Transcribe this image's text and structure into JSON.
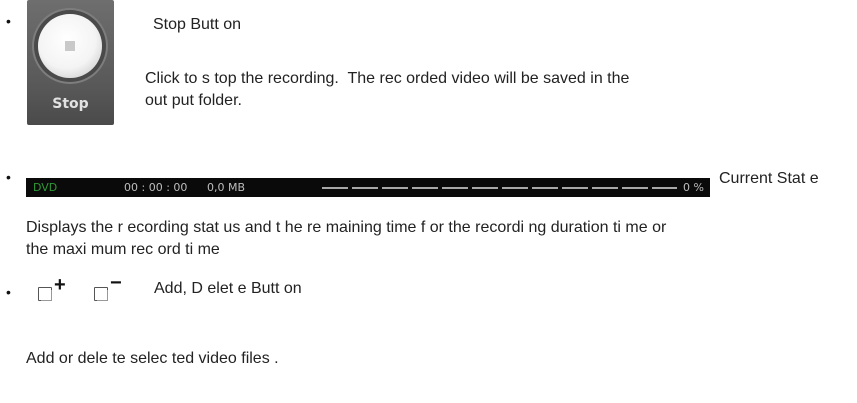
{
  "stop_section": {
    "bullet": "•",
    "button_label": "Stop",
    "title": "Stop Butt on",
    "desc_line1": "Click to s top the recording.  The rec orded video will be saved in the",
    "desc_line2": "out put folder."
  },
  "state_section": {
    "bullet": "•",
    "bar": {
      "mode": "DVD",
      "time": "00 : 00 : 00",
      "size": "0,0 MB",
      "percent_text": "0 %",
      "progress": 0,
      "mode_color": "#2f9a36"
    },
    "title": "Current Stat e",
    "desc_line1": "Displays the r ecording stat us and t he re maining time f or the recordi ng duration ti me or",
    "desc_line2": "the maxi mum rec ord ti me"
  },
  "add_delete_section": {
    "bullet": "•",
    "add_sign": "+",
    "delete_sign": "−",
    "title": "Add, D elet e Butt on",
    "desc": "Add or dele te selec ted video files ."
  }
}
